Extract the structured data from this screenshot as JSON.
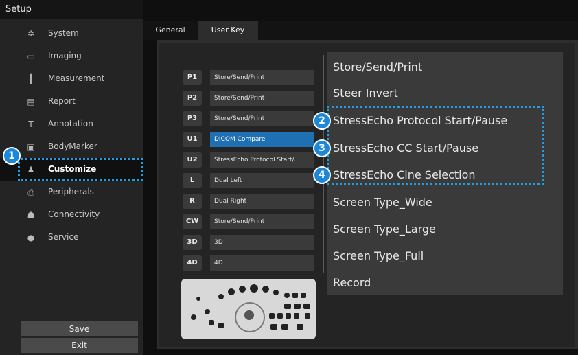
{
  "setup_title": "Setup",
  "menu": [
    {
      "label": "System",
      "icon": "gear-icon",
      "glyph": "✲"
    },
    {
      "label": "Imaging",
      "icon": "image-icon",
      "glyph": "▭"
    },
    {
      "label": "Measurement",
      "icon": "ruler-icon",
      "glyph": "┃"
    },
    {
      "label": "Report",
      "icon": "report-icon",
      "glyph": "▤"
    },
    {
      "label": "Annotation",
      "icon": "text-icon",
      "glyph": "T"
    },
    {
      "label": "BodyMarker",
      "icon": "bodymarker-icon",
      "glyph": "▣"
    },
    {
      "label": "Customize",
      "icon": "customize-icon",
      "glyph": "♟"
    },
    {
      "label": "Peripherals",
      "icon": "printer-icon",
      "glyph": "⎙"
    },
    {
      "label": "Connectivity",
      "icon": "network-icon",
      "glyph": "☗"
    },
    {
      "label": "Service",
      "icon": "service-icon",
      "glyph": "●"
    }
  ],
  "selected_menu": "Customize",
  "buttons": {
    "save": "Save",
    "exit": "Exit"
  },
  "tabs": [
    {
      "label": "General"
    },
    {
      "label": "User Key"
    }
  ],
  "active_tab": "User Key",
  "keys": [
    {
      "key": "P1",
      "value": "Store/Send/Print"
    },
    {
      "key": "P2",
      "value": "Store/Send/Print"
    },
    {
      "key": "P3",
      "value": "Store/Send/Print"
    },
    {
      "key": "U1",
      "value": "DICOM Compare"
    },
    {
      "key": "U2",
      "value": "StressEcho Protocol Start/..."
    },
    {
      "key": "L",
      "value": "Dual Left"
    },
    {
      "key": "R",
      "value": "Dual Right"
    },
    {
      "key": "CW",
      "value": "Store/Send/Print"
    },
    {
      "key": "3D",
      "value": "3D"
    },
    {
      "key": "4D",
      "value": "4D"
    }
  ],
  "dropdown_options": [
    "Store/Send/Print",
    "Steer Invert",
    "StressEcho Protocol Start/Pause",
    "StressEcho CC Start/Pause",
    "StressEcho Cine Selection",
    "Screen Type_Wide",
    "Screen Type_Large",
    "Screen Type_Full",
    "Record"
  ],
  "callouts": [
    "1",
    "2",
    "3",
    "4"
  ],
  "colors": {
    "accent": "#1e88d8",
    "highlight": "#1f6fb3",
    "outline": "#1fa0e0"
  }
}
